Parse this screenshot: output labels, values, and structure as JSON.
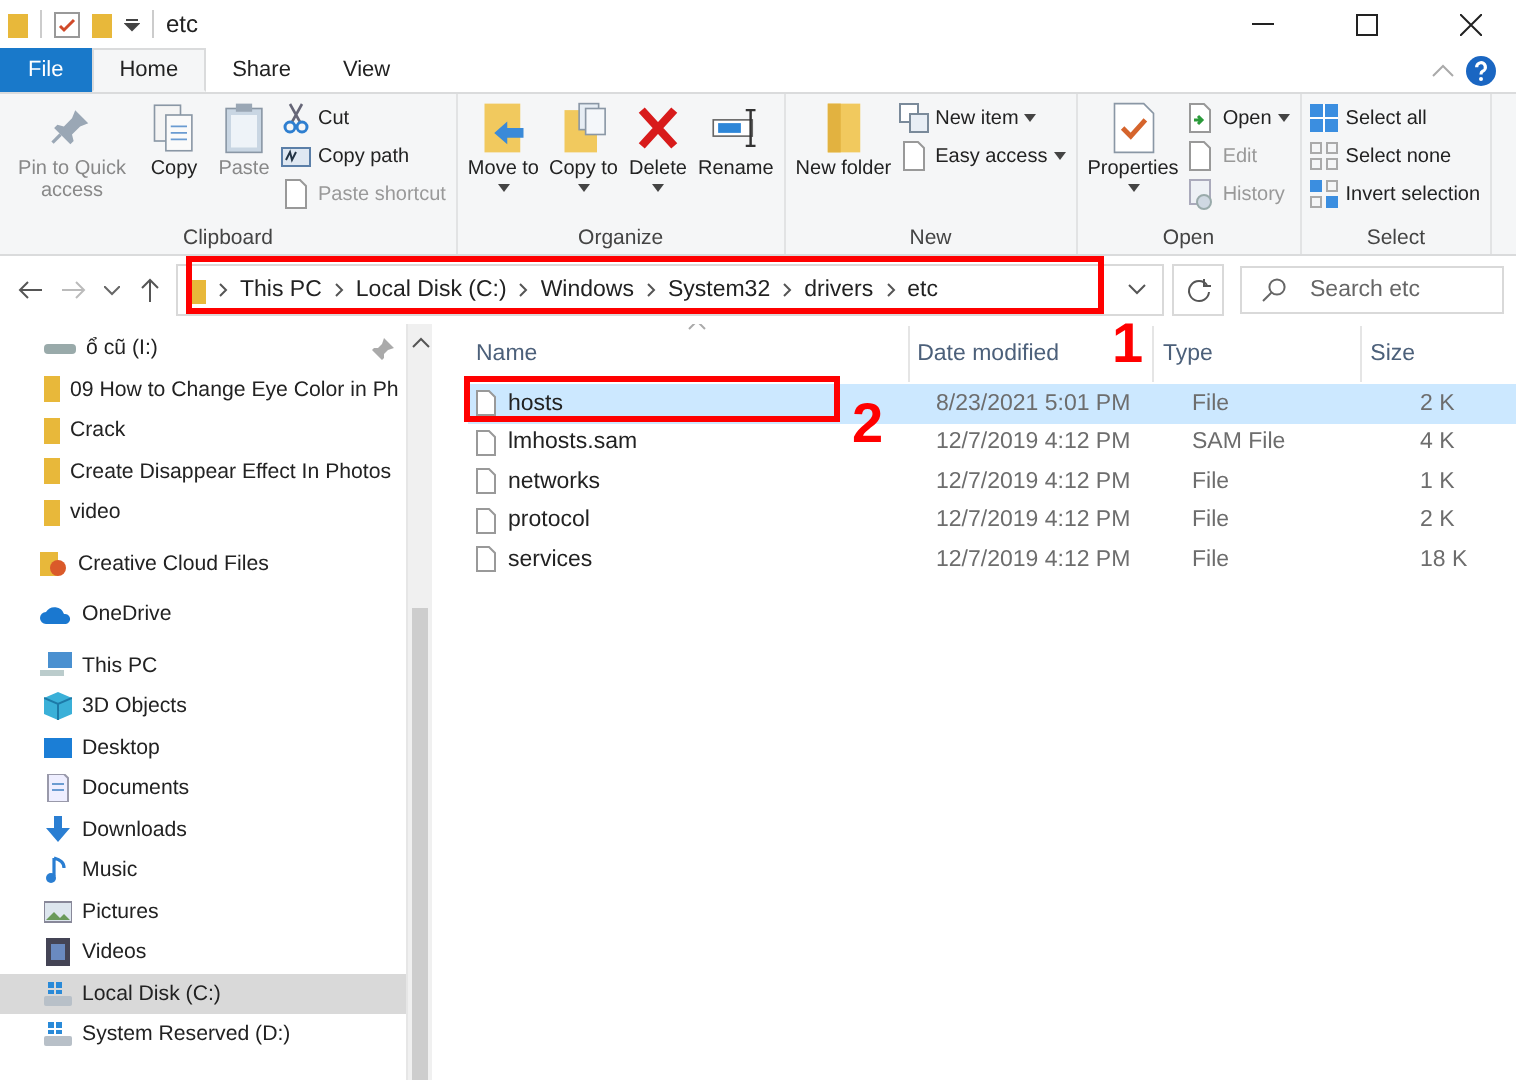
{
  "title_bar": {
    "title": "etc"
  },
  "ribbon_tabs": [
    {
      "label": "File",
      "kind": "file",
      "selected": false
    },
    {
      "label": "Home",
      "kind": "tab",
      "selected": true
    },
    {
      "label": "Share",
      "kind": "tab",
      "selected": false
    },
    {
      "label": "View",
      "kind": "tab",
      "selected": false
    }
  ],
  "ribbon_groups": [
    {
      "name": "Clipboard",
      "items": [
        {
          "label": "Pin to Quick access",
          "kind": "large",
          "disabled": true,
          "dropdown": false
        },
        {
          "label": "Copy",
          "kind": "large",
          "disabled": false,
          "dropdown": false
        },
        {
          "label": "Paste",
          "kind": "large",
          "disabled": true,
          "dropdown": false
        },
        {
          "label": "Cut",
          "kind": "small",
          "disabled": false,
          "dropdown": false
        },
        {
          "label": "Copy path",
          "kind": "small",
          "disabled": false,
          "dropdown": false
        },
        {
          "label": "Paste shortcut",
          "kind": "small",
          "disabled": true,
          "dropdown": false
        }
      ]
    },
    {
      "name": "Organize",
      "items": [
        {
          "label": "Move to",
          "kind": "large",
          "disabled": false,
          "dropdown": true
        },
        {
          "label": "Copy to",
          "kind": "large",
          "disabled": false,
          "dropdown": true
        },
        {
          "label": "Delete",
          "kind": "large",
          "disabled": false,
          "dropdown": true
        },
        {
          "label": "Rename",
          "kind": "large",
          "disabled": false,
          "dropdown": false
        }
      ]
    },
    {
      "name": "New",
      "items": [
        {
          "label": "New folder",
          "kind": "large",
          "disabled": false,
          "dropdown": false
        },
        {
          "label": "New item",
          "kind": "small",
          "disabled": false,
          "dropdown": true
        },
        {
          "label": "Easy access",
          "kind": "small",
          "disabled": false,
          "dropdown": true
        }
      ]
    },
    {
      "name": "Open",
      "items": [
        {
          "label": "Properties",
          "kind": "large",
          "disabled": false,
          "dropdown": true
        },
        {
          "label": "Open",
          "kind": "small",
          "disabled": false,
          "dropdown": true
        },
        {
          "label": "Edit",
          "kind": "small",
          "disabled": true,
          "dropdown": false
        },
        {
          "label": "History",
          "kind": "small",
          "disabled": true,
          "dropdown": false
        }
      ]
    },
    {
      "name": "Select",
      "items": [
        {
          "label": "Select all",
          "kind": "small",
          "disabled": false,
          "dropdown": false
        },
        {
          "label": "Select none",
          "kind": "small",
          "disabled": false,
          "dropdown": false
        },
        {
          "label": "Invert selection",
          "kind": "small",
          "disabled": false,
          "dropdown": false
        }
      ]
    }
  ],
  "address_bar": {
    "path": [
      "This PC",
      "Local Disk (C:)",
      "Windows",
      "System32",
      "drivers",
      "etc"
    ],
    "search_placeholder": "Search etc"
  },
  "navigation": {
    "quick_access_items": [
      {
        "label": "ổ cũ (I:)",
        "kind": "drive",
        "pinned": true,
        "selected": false
      },
      {
        "label": "09 How to Change Eye Color in Ph",
        "kind": "folder",
        "pinned": false,
        "selected": false
      },
      {
        "label": "Crack",
        "kind": "folder",
        "pinned": false,
        "selected": false
      },
      {
        "label": "Create Disappear Effect In Photos",
        "kind": "folder",
        "pinned": false,
        "selected": false
      },
      {
        "label": "video",
        "kind": "folder",
        "pinned": false,
        "selected": false
      }
    ],
    "roots": [
      {
        "label": "Creative Cloud Files",
        "kind": "cc",
        "selected": false
      },
      {
        "label": "OneDrive",
        "kind": "onedrive",
        "selected": false
      },
      {
        "label": "This PC",
        "kind": "pc",
        "selected": false,
        "children": [
          {
            "label": "3D Objects",
            "kind": "objects",
            "selected": false
          },
          {
            "label": "Desktop",
            "kind": "desktop",
            "selected": false
          },
          {
            "label": "Documents",
            "kind": "documents",
            "selected": false
          },
          {
            "label": "Downloads",
            "kind": "downloads",
            "selected": false
          },
          {
            "label": "Music",
            "kind": "music",
            "selected": false
          },
          {
            "label": "Pictures",
            "kind": "pictures",
            "selected": false
          },
          {
            "label": "Videos",
            "kind": "videos",
            "selected": false
          },
          {
            "label": "Local Disk (C:)",
            "kind": "disk",
            "selected": true
          },
          {
            "label": "System Reserved (D:)",
            "kind": "disk",
            "selected": false
          }
        ]
      }
    ]
  },
  "file_list": {
    "columns": [
      "Name",
      "Date modified",
      "Type",
      "Size"
    ],
    "rows": [
      {
        "name": "hosts",
        "date_modified": "8/23/2021 5:01 PM",
        "type": "File",
        "size": "2 K",
        "selected": true
      },
      {
        "name": "lmhosts.sam",
        "date_modified": "12/7/2019 4:12 PM",
        "type": "SAM File",
        "size": "4 K",
        "selected": false
      },
      {
        "name": "networks",
        "date_modified": "12/7/2019 4:12 PM",
        "type": "File",
        "size": "1 K",
        "selected": false
      },
      {
        "name": "protocol",
        "date_modified": "12/7/2019 4:12 PM",
        "type": "File",
        "size": "2 K",
        "selected": false
      },
      {
        "name": "services",
        "date_modified": "12/7/2019 4:12 PM",
        "type": "File",
        "size": "18 K",
        "selected": false
      }
    ]
  },
  "annotations": [
    {
      "number": "1"
    },
    {
      "number": "2"
    }
  ]
}
